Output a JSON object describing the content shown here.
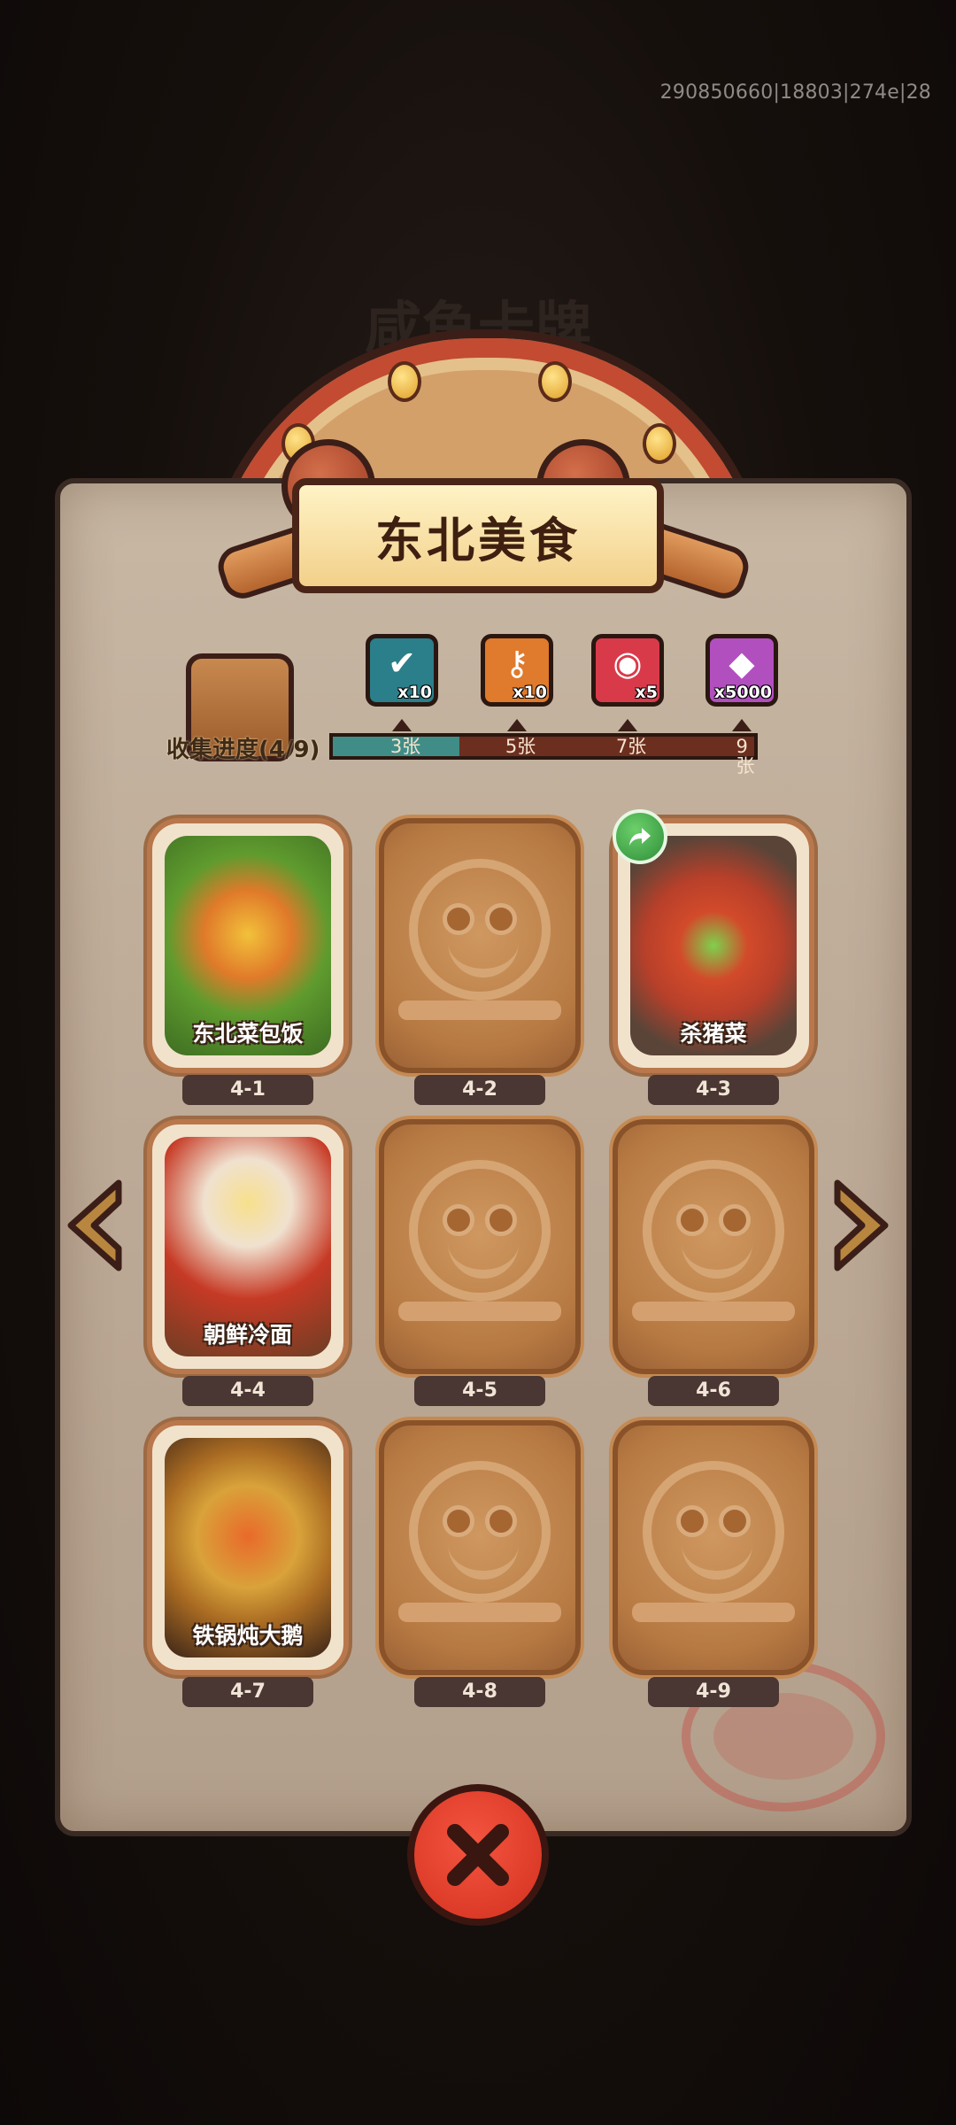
{
  "debug_id": "290850660|18803|274e|28",
  "background_title": "咸鱼卡牌",
  "panel": {
    "title": "东北美食"
  },
  "collection": {
    "label": "收集进度(4/9)",
    "collected": 4,
    "total": 9,
    "fill_fraction": 0.3,
    "milestones": [
      {
        "label": "3张",
        "reward_icon": "chest-icon",
        "reward_qty": "x10",
        "frame_color": "#2b7f8a"
      },
      {
        "label": "5张",
        "reward_icon": "key-icon",
        "reward_qty": "x10",
        "frame_color": "#e07a2c"
      },
      {
        "label": "7张",
        "reward_icon": "orb-icon",
        "reward_qty": "x5",
        "frame_color": "#d93a4a"
      },
      {
        "label": "9张",
        "reward_icon": "gem-icon",
        "reward_qty": "x5000",
        "frame_color": "#b24fbf"
      }
    ]
  },
  "cards": [
    {
      "id": "4-1",
      "name": "东北菜包饭",
      "unlocked": true
    },
    {
      "id": "4-2",
      "name": "",
      "unlocked": false
    },
    {
      "id": "4-3",
      "name": "杀猪菜",
      "unlocked": true,
      "shareable": true
    },
    {
      "id": "4-4",
      "name": "朝鲜冷面",
      "unlocked": true
    },
    {
      "id": "4-5",
      "name": "",
      "unlocked": false
    },
    {
      "id": "4-6",
      "name": "",
      "unlocked": false
    },
    {
      "id": "4-7",
      "name": "铁锅炖大鹅",
      "unlocked": true
    },
    {
      "id": "4-8",
      "name": "",
      "unlocked": false
    },
    {
      "id": "4-9",
      "name": "",
      "unlocked": false
    }
  ],
  "controls": {
    "prev_icon": "chevron-left-icon",
    "next_icon": "chevron-right-icon",
    "close_icon": "close-icon"
  },
  "colors": {
    "progress_fill": "#3f8d86",
    "progress_track": "#6b2e1f",
    "close_button": "#e5402c"
  }
}
